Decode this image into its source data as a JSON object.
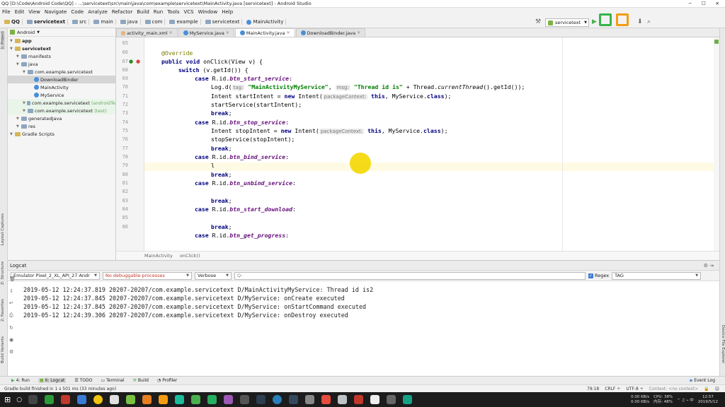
{
  "window": {
    "title": "QQ [D:\\Code\\Android Code\\QQ] - ...\\servicetext\\src\\main\\java\\com\\example\\servicetext\\MainActivity.java [servicetext] - Android Studio",
    "minimize": "─",
    "maximize": "☐",
    "close": "✕"
  },
  "menu": [
    "File",
    "Edit",
    "View",
    "Navigate",
    "Code",
    "Analyze",
    "Refactor",
    "Build",
    "Run",
    "Tools",
    "VCS",
    "Window",
    "Help"
  ],
  "nav": {
    "crumbs": [
      "QQ",
      "servicetext",
      "src",
      "main",
      "java",
      "com",
      "example",
      "servicetext",
      "MainActivity"
    ],
    "run_config": "servicetext"
  },
  "project_panel": {
    "view": "Android",
    "tree": [
      {
        "label": "app",
        "indent": 0,
        "bold": true
      },
      {
        "label": "servicetext",
        "indent": 0,
        "bold": true
      },
      {
        "label": "manifests",
        "indent": 1
      },
      {
        "label": "java",
        "indent": 1
      },
      {
        "label": "com.example.servicetext",
        "indent": 2
      },
      {
        "label": "DownloadBinder",
        "indent": 3,
        "selected": true
      },
      {
        "label": "MainActivity",
        "indent": 3
      },
      {
        "label": "MyService",
        "indent": 3
      },
      {
        "label": "com.example.servicetext",
        "suffix": "(androidTe",
        "indent": 2,
        "tinted": true
      },
      {
        "label": "com.example.servicetext",
        "suffix": "(test)",
        "indent": 2,
        "tinted": true
      },
      {
        "label": "generatedJava",
        "indent": 1
      },
      {
        "label": "res",
        "indent": 1
      },
      {
        "label": "Gradle Scripts",
        "indent": 0
      }
    ]
  },
  "left_stripe_tabs": [
    "1: Project",
    "Layout Captures",
    "Z: Structure",
    "2: Favorites",
    "Build Variants"
  ],
  "right_stripe_tabs": [
    "Device File Explorer"
  ],
  "editor_tabs": [
    {
      "label": "activity_main.xml",
      "active": false
    },
    {
      "label": "MyService.java",
      "active": false
    },
    {
      "label": "MainActivity.java",
      "active": true
    },
    {
      "label": "DownloadBinder.java",
      "active": false
    }
  ],
  "editor": {
    "line_numbers": [
      "65",
      "66",
      "67",
      "68",
      "69",
      "70",
      "71",
      "72",
      "73",
      "74",
      "75",
      "76",
      "77",
      "78",
      "79",
      "80",
      "81",
      "82",
      "83",
      "84",
      "85",
      "86"
    ],
    "code": {
      "l65": "",
      "l66_ann": "@Override",
      "l67_kw1": "public",
      "l67_kw2": "void",
      "l67_rest": " onClick(View v) {",
      "l68_kw": "switch",
      "l68_rest": " (v.getId()) {",
      "case": "case",
      "rid": " R.id.",
      "f_start": "btn_start_service",
      "f_stop": "btn_stop_service",
      "f_bind": "btn_bind_service",
      "f_unbind": "btn_unbind_service",
      "f_download": "btn_start_download",
      "f_progress": "btn_get_progress",
      "colon": ":",
      "l70_a": "Log.d(",
      "hint_tag": "tag:",
      "str_tag": "\"MainActivityMyService\"",
      "comma": ", ",
      "hint_msg": "msg:",
      "str_msg": "\"Thread id is\"",
      "l70_b": " + Thread.",
      "l70_itl": "currentThread",
      "l70_c": "().getId());",
      "l71_a": "Intent startIntent = ",
      "new": "new",
      "l71_b": " Intent(",
      "hint_ctx": "packageContext:",
      "this": "this",
      "l71_c": ", MyService.",
      "class": "class",
      "close": ");",
      "l72": "startService(startIntent);",
      "break": "break",
      "semi": ";",
      "l75_a": "Intent stopIntent = ",
      "l76": "stopService(stopIntent);",
      "l79": "l"
    }
  },
  "editor_breadcrumb": [
    "MainActivity",
    "onClick()"
  ],
  "logcat": {
    "title": "Logcat",
    "device": "Emulator Pixel_2_XL_API_27 Andr",
    "process": "No debuggable processes",
    "level": "Verbose",
    "search_placeholder": "Q-",
    "regex_label": "Regex",
    "tag_filter": "TAG",
    "lines": [
      "2019-05-12 12:24:37.819 20207-20207/com.example.servicetext D/MainActivityMyService: Thread id is2",
      "2019-05-12 12:24:37.845 20207-20207/com.example.servicetext D/MyService: onCreate executed",
      "2019-05-12 12:24:37.845 20207-20207/com.example.servicetext D/MyService: onStartCommand executed",
      "2019-05-12 12:24:39.306 20207-20207/com.example.servicetext D/MyService: onDestroy executed"
    ]
  },
  "bottom_tabs": [
    "4: Run",
    "6: Logcat",
    "TODO",
    "Terminal",
    "Build",
    "Profiler"
  ],
  "event_log": "Event Log",
  "status": {
    "message": "Gradle build finished in 1 s 501 ms (33 minutes ago)",
    "position": "79:18",
    "line_sep": "CRLF ÷",
    "encoding": "UTF-8 ÷",
    "context": "Context: <no context>"
  },
  "taskbar": {
    "net_up": "0.00 KB/s",
    "net_down": "0.00 KB/s",
    "cpu": "CPU: 38%",
    "mem": "内存: 48%",
    "time": "12:57",
    "date": "2019/5/12"
  },
  "colors": {
    "keyword": "#000080",
    "string": "#008000",
    "field": "#660e7a",
    "annotation": "#808000",
    "cursor_highlight": "#f4d700",
    "logo_green": "#37b34a",
    "logo_orange": "#f39c12",
    "logo_red": "#e74c3c",
    "logo_blue": "#3498db"
  }
}
